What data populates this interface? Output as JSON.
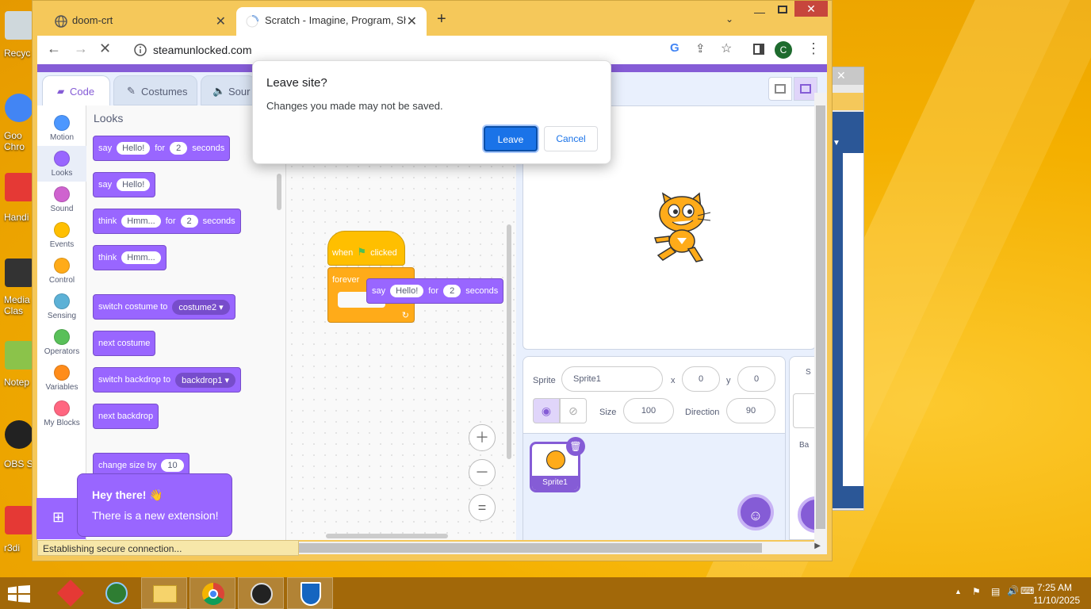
{
  "desktop": {
    "icons": [
      {
        "label": "Recyc",
        "icon": "recycle-bin-icon",
        "color": "#cfd8dc"
      },
      {
        "label": "Goo\nChro",
        "icon": "chrome-icon",
        "color": "#4285f4"
      },
      {
        "label": "Handi",
        "icon": "handi-icon",
        "color": "#e53935"
      },
      {
        "label": "Media\nClas",
        "icon": "media-player-icon",
        "color": "#333333"
      },
      {
        "label": "Notep",
        "icon": "notepad-icon",
        "color": "#8bc34a"
      },
      {
        "label": "OBS S",
        "icon": "obs-icon",
        "color": "#222222"
      },
      {
        "label": "r3di",
        "icon": "r3di-icon",
        "color": "#e53935"
      }
    ]
  },
  "browser": {
    "tabs": [
      {
        "title": "doom-crt",
        "icon": "globe-icon",
        "active": false
      },
      {
        "title": "Scratch - Imagine, Program, Sha",
        "icon": "loading-icon",
        "active": true
      }
    ],
    "new_tab_label": "+",
    "url": "steamunlocked.com",
    "profile_initial": "C",
    "status_text": "Establishing secure connection..."
  },
  "scratch": {
    "tabs": [
      {
        "label": "Code",
        "icon": "code-icon",
        "active": true
      },
      {
        "label": "Costumes",
        "icon": "brush-icon",
        "active": false
      },
      {
        "label": "Sour",
        "icon": "speaker-icon",
        "active": false
      }
    ],
    "categories": [
      {
        "label": "Motion",
        "color": "#4c97ff"
      },
      {
        "label": "Looks",
        "color": "#9966ff"
      },
      {
        "label": "Sound",
        "color": "#cf63cf"
      },
      {
        "label": "Events",
        "color": "#ffbf00"
      },
      {
        "label": "Control",
        "color": "#ffab19"
      },
      {
        "label": "Sensing",
        "color": "#5cb1d6"
      },
      {
        "label": "Operators",
        "color": "#59c059"
      },
      {
        "label": "Variables",
        "color": "#ff8c1a"
      },
      {
        "label": "My Blocks",
        "color": "#ff6680"
      }
    ],
    "palette_heading": "Looks",
    "blocks": {
      "b1": {
        "a": "say",
        "v1": "Hello!",
        "b": "for",
        "v2": "2",
        "c": "seconds"
      },
      "b2": {
        "a": "say",
        "v1": "Hello!"
      },
      "b3": {
        "a": "think",
        "v1": "Hmm...",
        "b": "for",
        "v2": "2",
        "c": "seconds"
      },
      "b4": {
        "a": "think",
        "v1": "Hmm..."
      },
      "b5": {
        "a": "switch costume to",
        "v1": "costume2 ▾"
      },
      "b6": {
        "a": "next costume"
      },
      "b7": {
        "a": "switch backdrop to",
        "v1": "backdrop1 ▾"
      },
      "b8": {
        "a": "next backdrop"
      },
      "b9": {
        "a": "change size by",
        "v1": "10"
      }
    },
    "script": {
      "hat": {
        "a": "when",
        "b": "clicked"
      },
      "forever": "forever",
      "say": {
        "a": "say",
        "v1": "Hello!",
        "b": "for",
        "v2": "2",
        "c": "seconds"
      }
    },
    "sprite_info": {
      "sprite_label": "Sprite",
      "sprite_name": "Sprite1",
      "x_label": "x",
      "x": "0",
      "y_label": "y",
      "y": "0",
      "size_label": "Size",
      "size": "100",
      "direction_label": "Direction",
      "direction": "90"
    },
    "sprite_thumb_label": "Sprite1",
    "stage_mini_label1": "S",
    "stage_mini_label2": "Ba",
    "tooltip": {
      "title": "Hey there! 👋",
      "body": "There is a new extension!"
    }
  },
  "dialog": {
    "title": "Leave site?",
    "message": "Changes you made may not be saved.",
    "leave_label": "Leave",
    "cancel_label": "Cancel"
  },
  "taskbar": {
    "time": "7:25 AM",
    "date": "11/10/2025",
    "apps": [
      "start-icon",
      "handi-icon",
      "globe-icon",
      "file-explorer-icon",
      "chrome-icon",
      "obs-icon",
      "defender-icon"
    ]
  }
}
